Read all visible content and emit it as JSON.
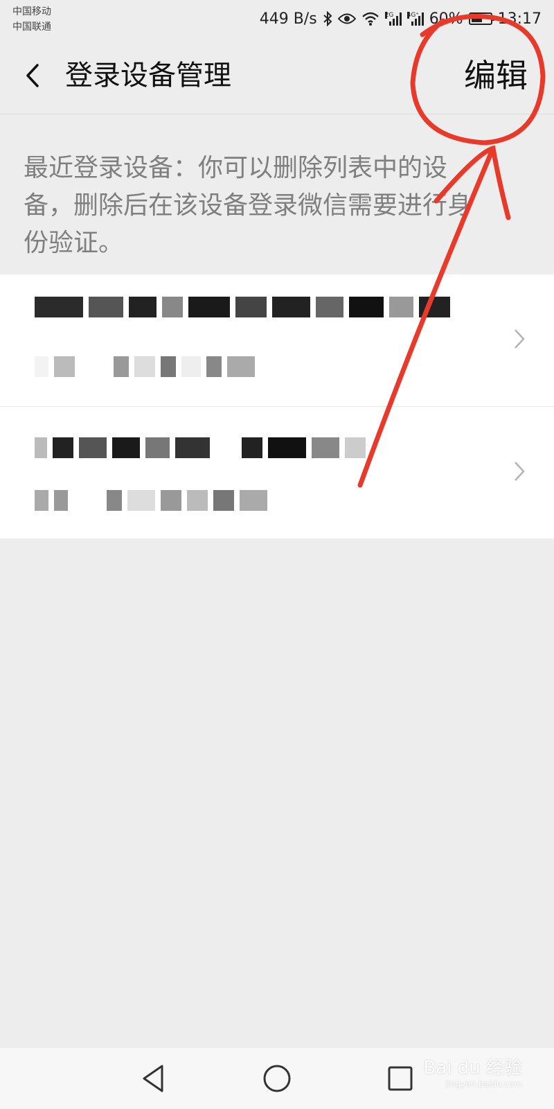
{
  "status_bar": {
    "carrier_1": "中国移动",
    "carrier_2": "中国联通",
    "net_speed": "449 B/s",
    "signal_1_type": "2G",
    "signal_2_type": "4G⁺",
    "battery": "60%",
    "time": "13:17"
  },
  "header": {
    "title": "登录设备管理",
    "edit_label": "编辑"
  },
  "description": "最近登录设备：你可以删除列表中的设备，删除后在该设备登录微信需要进行身份验证。",
  "devices": [
    {
      "name_redacted": true,
      "detail_redacted": true
    },
    {
      "name_redacted": true,
      "detail_redacted": true
    }
  ],
  "watermark": {
    "brand": "Bai du 经验",
    "url": "jingyan.baidu.com"
  },
  "colors": {
    "background": "#ededed",
    "annotation": "#e83a2a",
    "text_secondary": "#7f7f7f"
  }
}
